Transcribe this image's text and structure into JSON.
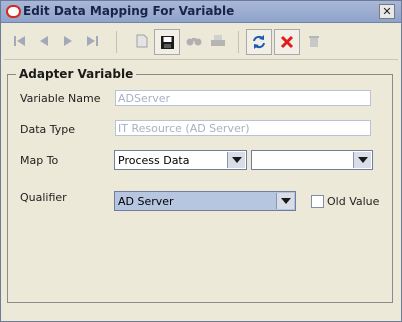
{
  "window": {
    "title": "Edit Data Mapping For Variable",
    "close_glyph": "✕"
  },
  "toolbar": {
    "icons": [
      "first-icon",
      "previous-icon",
      "next-icon",
      "last-icon",
      "new-icon",
      "save-icon",
      "find-icon",
      "print-icon",
      "refresh-icon",
      "delete-icon",
      "trash-icon"
    ]
  },
  "panel": {
    "legend": "Adapter Variable",
    "variable_name_label": "Variable Name",
    "variable_name_value": "ADServer",
    "data_type_label": "Data Type",
    "data_type_value": "IT Resource (AD Server)",
    "map_to_label": "Map To",
    "map_to_value": "Process Data",
    "map_to_secondary_value": "",
    "qualifier_label": "Qualifier",
    "qualifier_value": "AD Server",
    "old_value_label": "Old Value",
    "old_value_checked": false
  },
  "colors": {
    "accent_red": "#d32b1e",
    "title_bar": "#8fa3c9",
    "window_bg": "#ece9d8"
  }
}
